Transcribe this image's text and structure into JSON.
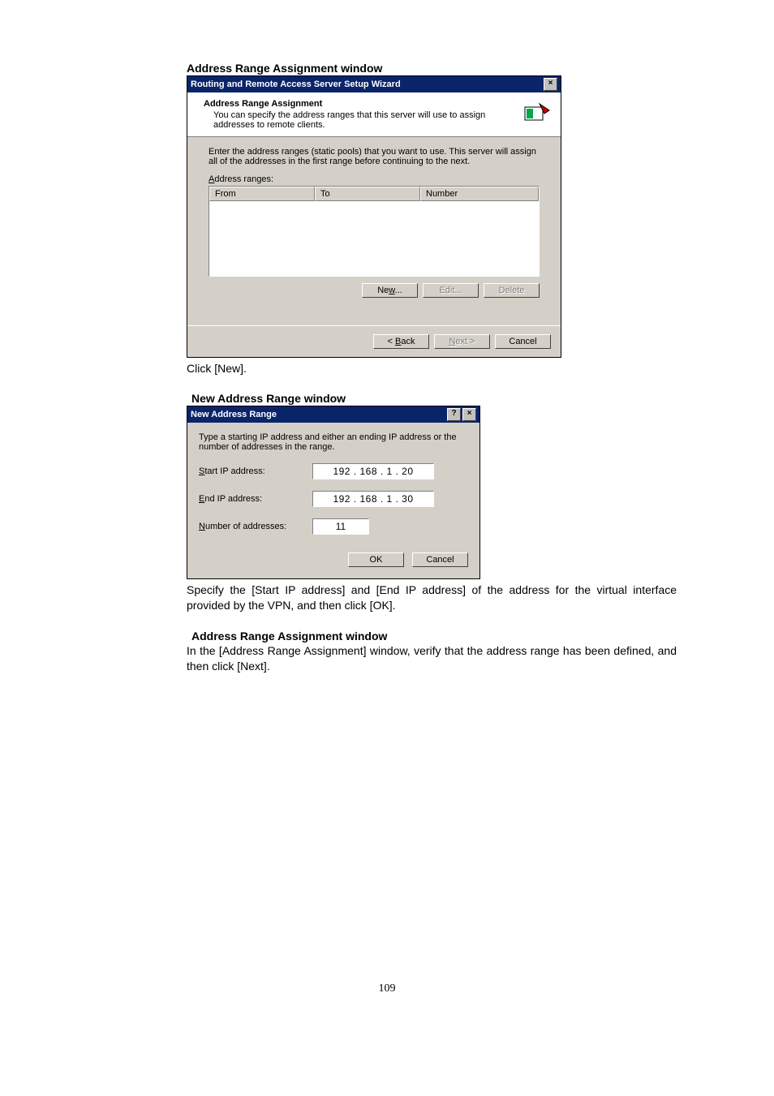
{
  "sec1": {
    "heading": "Address Range Assignment window",
    "title": "Routing and Remote Access Server Setup Wizard",
    "header_title": "Address Range Assignment",
    "header_sub": "You can specify the address ranges that this server will use to assign addresses to remote clients.",
    "instr": "Enter the address ranges (static pools) that you want to use. This server will assign all of the addresses in the first range before continuing to the next.",
    "label_prefix": "A",
    "label_rest": "ddress ranges:",
    "col_from": "From",
    "col_to": "To",
    "col_number": "Number",
    "btn_new_prefix": "Ne",
    "btn_new_u": "w",
    "btn_new_suffix": "...",
    "btn_edit": "Edit...",
    "btn_delete": "Delete",
    "btn_back_lt": "< ",
    "btn_back_u": "B",
    "btn_back_rest": "ack",
    "btn_next_u": "N",
    "btn_next_rest": "ext >",
    "btn_cancel": "Cancel",
    "after": "Click [New]."
  },
  "sec2": {
    "heading": "New Address Range window",
    "title": "New Address Range",
    "instr": "Type a starting IP address and either an ending IP address or the number of addresses in the range.",
    "lbl_start_u": "S",
    "lbl_start_rest": "tart IP address:",
    "lbl_end_u": "E",
    "lbl_end_rest": "nd IP address:",
    "lbl_num_u": "N",
    "lbl_num_rest": "umber of addresses:",
    "ip_start": "192 . 168 .  1  .  20",
    "ip_end": "192 . 168 .  1  .  30",
    "num": "11",
    "btn_ok": "OK",
    "btn_cancel": "Cancel",
    "after": "Specify the [Start IP address] and [End IP address] of the address for the virtual interface provided by the VPN, and then click [OK]."
  },
  "sec3": {
    "heading": "Address Range Assignment window",
    "para": "In the [Address Range Assignment] window, verify that the address range has been defined, and then click [Next]."
  },
  "page_num": "109"
}
